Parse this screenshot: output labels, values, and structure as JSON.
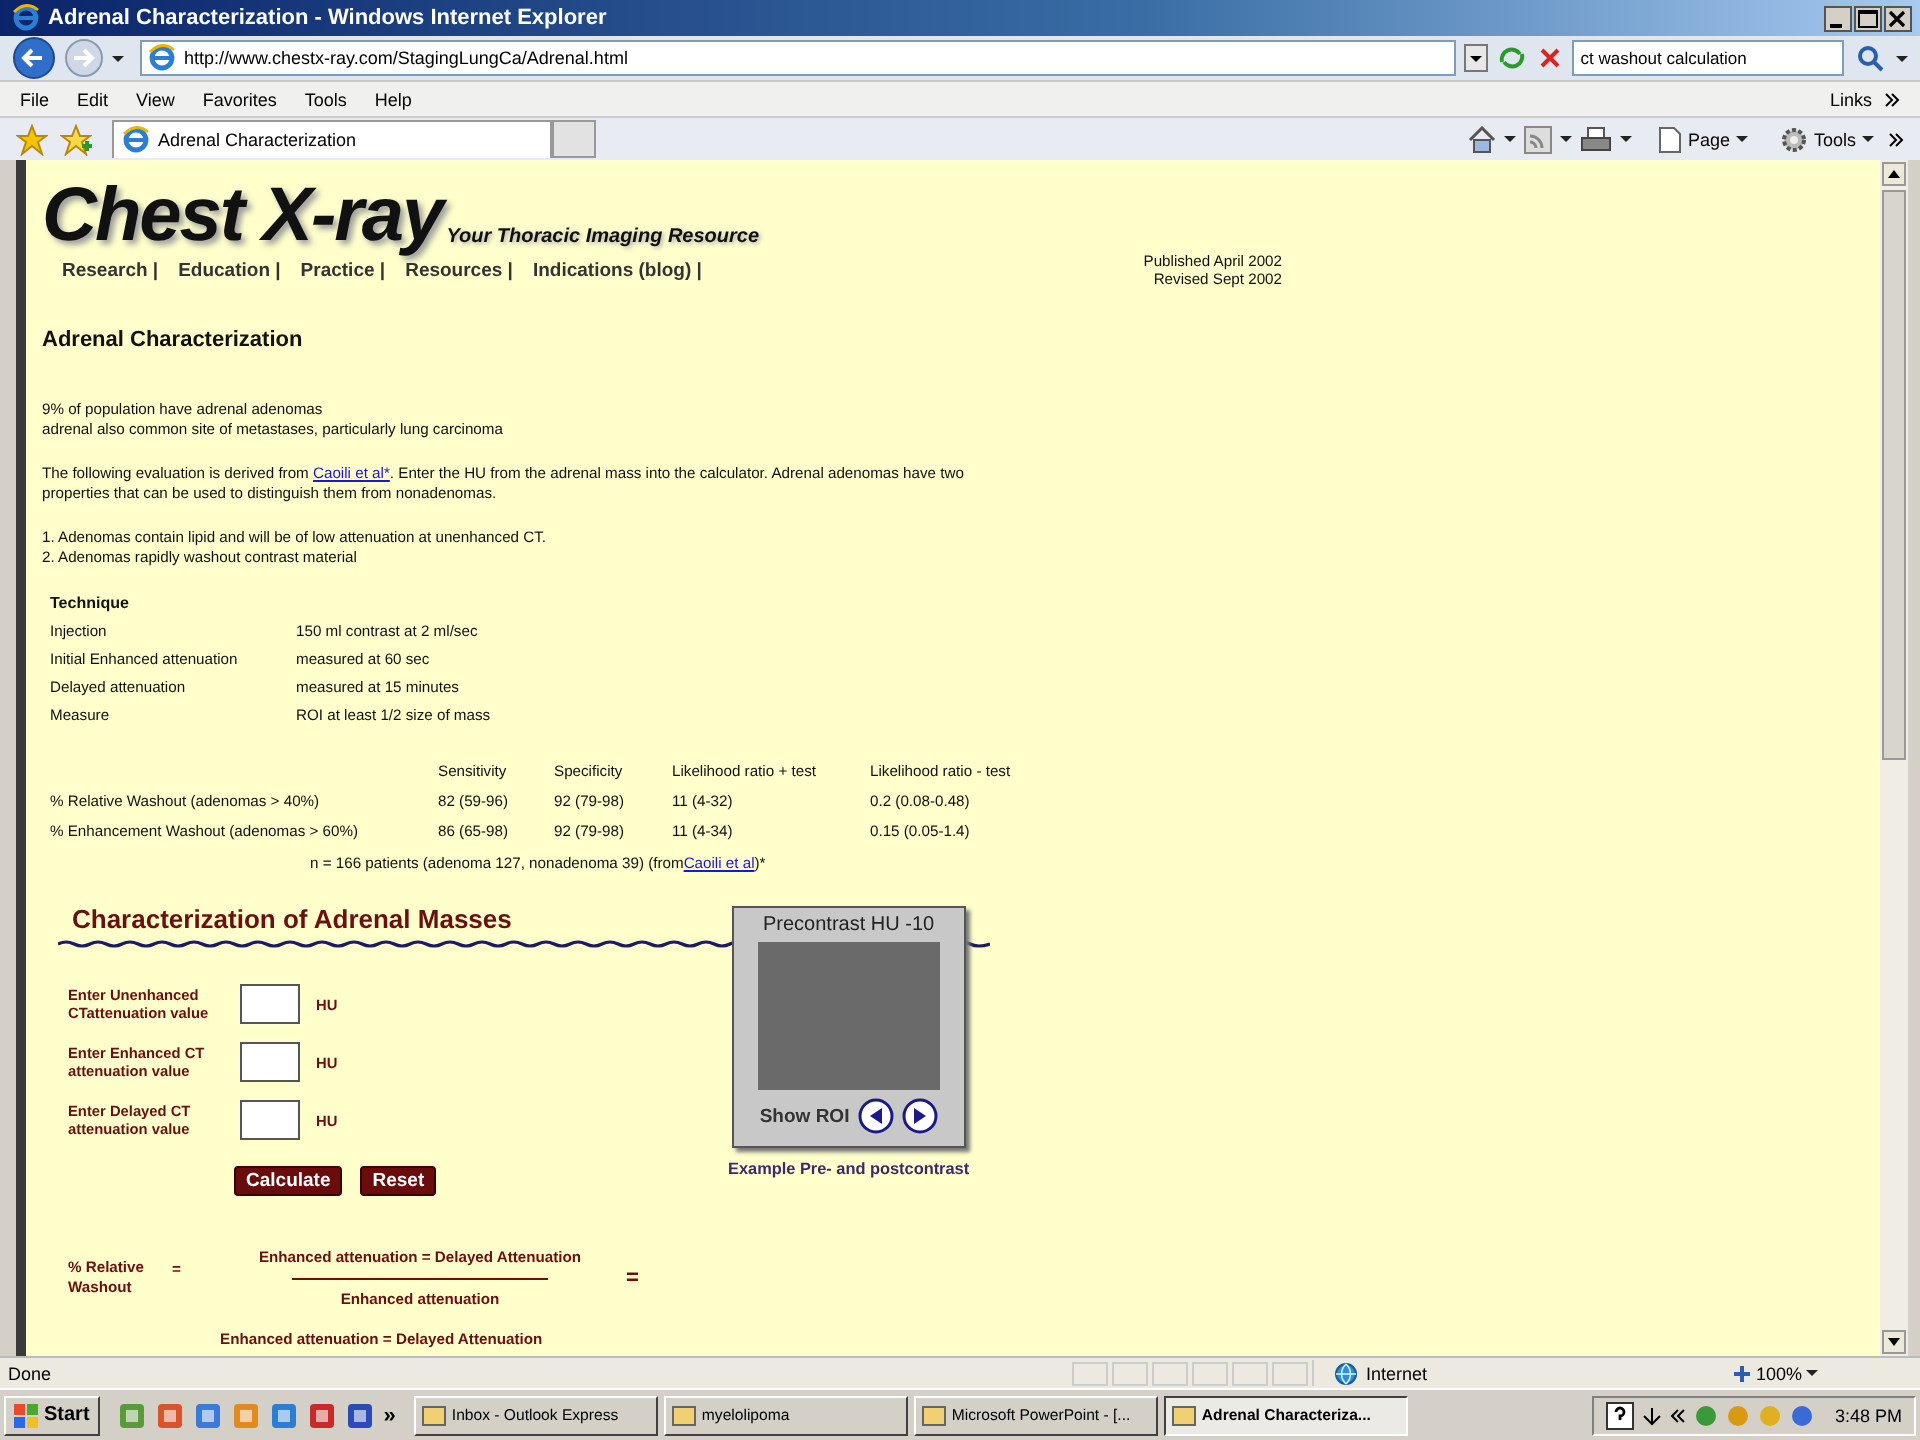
{
  "window": {
    "title": "Adrenal Characterization - Windows Internet Explorer"
  },
  "address_bar": {
    "url": "http://www.chestx-ray.com/StagingLungCa/Adrenal.html",
    "search_value": "ct washout calculation"
  },
  "menu": [
    "File",
    "Edit",
    "View",
    "Favorites",
    "Tools",
    "Help"
  ],
  "links_label": "Links",
  "tabs": [
    {
      "label": "Adrenal Characterization",
      "selected": true
    }
  ],
  "command_bar": [
    "Page",
    "Tools"
  ],
  "page": {
    "logo": "Chest X-ray",
    "tagline": "Your Thoracic Imaging Resource",
    "nav": [
      "Research |",
      "Education |",
      "Practice |",
      "Resources |",
      "Indications (blog) |"
    ],
    "published": [
      "Published April 2002",
      "Revised Sept 2002"
    ],
    "heading": "Adrenal Characterization",
    "intro": [
      "9% of population have adrenal adenomas",
      "adrenal also common site of metastases, particularly lung carcinoma"
    ],
    "paragraph": {
      "before": "The following evaluation is derived from ",
      "link": "Caoili et al*",
      "after": ". Enter the HU from the adrenal mass into the calculator. Adrenal adenomas have two properties that can be used to distinguish them from nonadenomas."
    },
    "findings": [
      "1. Adenomas contain lipid and will be of low attenuation at unenhanced CT.",
      "2. Adenomas rapidly washout contrast material"
    ],
    "technique": {
      "title": "Technique",
      "rows": [
        {
          "label": "Injection",
          "value": "150 ml contrast at 2 ml/sec"
        },
        {
          "label": "Initial Enhanced attenuation",
          "value": "measured at 60 sec"
        },
        {
          "label": "Delayed attenuation",
          "value": "measured at 15 minutes"
        },
        {
          "label": "Measure",
          "value": "ROI at least 1/2 size of mass"
        }
      ]
    },
    "stats": {
      "columns": [
        "Sensitivity",
        "Specificity",
        "Likelihood ratio + test",
        "Likelihood ratio - test"
      ],
      "rows": [
        {
          "label": "% Relative Washout (adenomas > 40%)",
          "cells": [
            "82 (59-96)",
            "92 (79-98)",
            "11 (4-32)",
            "0.2 (0.08-0.48)"
          ]
        },
        {
          "label": "% Enhancement Washout (adenomas > 60%)",
          "cells": [
            "86 (65-98)",
            "92 (79-98)",
            "11 (4-34)",
            "0.15 (0.05-1.4)"
          ]
        }
      ]
    },
    "note": {
      "before": "n = 166 patients (adenoma 127, nonadenoma 39) (from",
      "link": "Caoili et al",
      "after": ")*"
    },
    "calculator": {
      "title": "Characterization of Adrenal Masses",
      "fields": [
        {
          "label": "Enter Unenhanced CTattenuation value",
          "unit": "HU"
        },
        {
          "label": "Enter Enhanced CT attenuation value",
          "unit": "HU"
        },
        {
          "label": "Enter Delayed CT attenuation value",
          "unit": "HU"
        }
      ],
      "buttons": [
        "Calculate",
        "Reset"
      ],
      "formula": {
        "label": "% Relative Washout",
        "label_equals": "=",
        "numerator": "Enhanced attenuation = Delayed Attenuation",
        "denominator": "Enhanced attenuation",
        "result_equals": "="
      },
      "next_numerator": "Enhanced attenuation = Delayed Attenuation"
    },
    "example": {
      "title": "Precontrast HU -10",
      "show_roi": "Show ROI",
      "caption": "Example Pre- and postcontrast"
    }
  },
  "status_bar": {
    "text": "Done",
    "zone": "Internet",
    "zoom": "100%"
  },
  "taskbar": {
    "start": "Start",
    "more": "»",
    "tasks": [
      {
        "label": "Inbox - Outlook Express",
        "selected": false
      },
      {
        "label": "myelolipoma",
        "selected": false
      },
      {
        "label": "Microsoft PowerPoint - [...",
        "selected": false
      },
      {
        "label": "Adrenal Characteriza...",
        "selected": true
      }
    ],
    "clock": "3:48 PM"
  }
}
